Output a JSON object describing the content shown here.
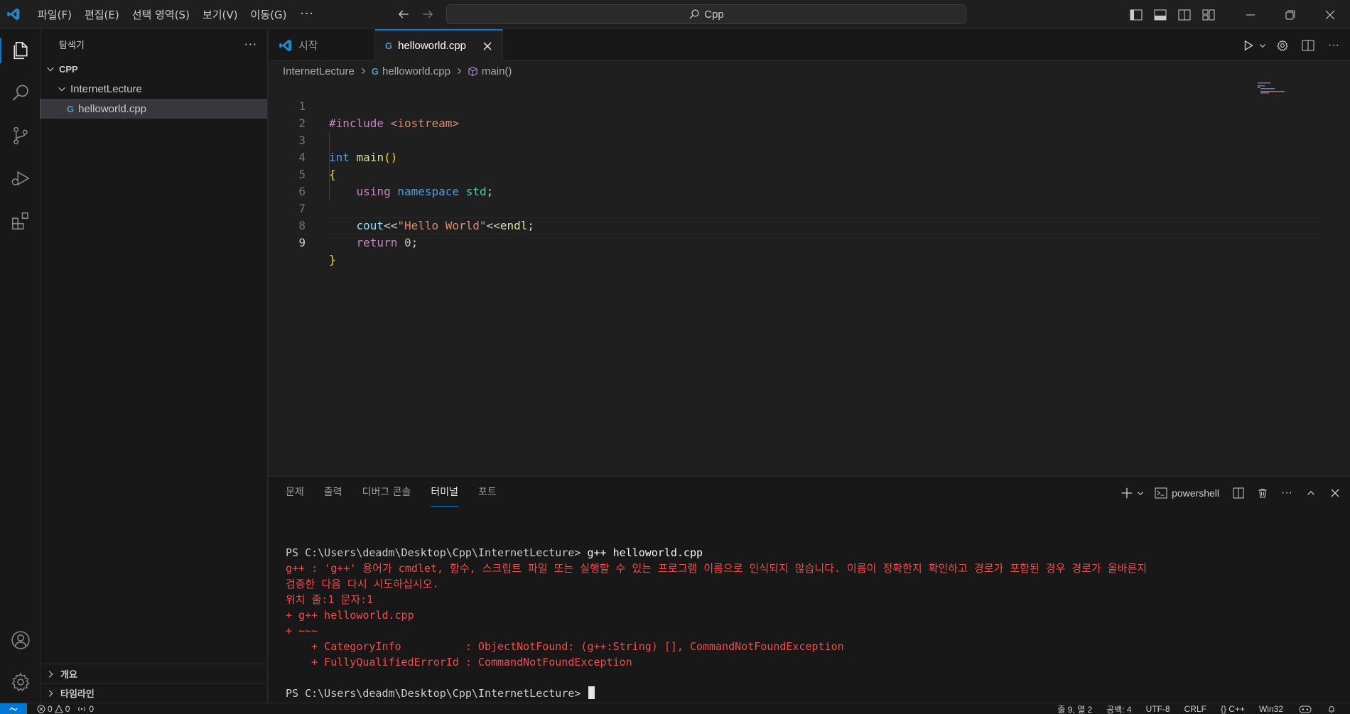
{
  "titlebar": {
    "menus": [
      "파일(F)",
      "편집(E)",
      "선택 영역(S)",
      "보기(V)",
      "이동(G)"
    ],
    "more": "···",
    "search_text": "Cpp"
  },
  "sidebar": {
    "title": "탐색기",
    "more": "···",
    "root": "CPP",
    "folder": "InternetLecture",
    "file": "helloworld.cpp",
    "file_icon": "G",
    "sections": [
      "개요",
      "타임라인"
    ]
  },
  "tabs": [
    {
      "label": "시작"
    },
    {
      "label": "helloworld.cpp",
      "icon": "G"
    }
  ],
  "breadcrumb": {
    "folder": "InternetLecture",
    "file": "helloworld.cpp",
    "symbol": "main()"
  },
  "editor": {
    "line_numbers": [
      "1",
      "2",
      "3",
      "4",
      "5",
      "6",
      "7",
      "8",
      "9"
    ],
    "current_line": 9
  },
  "panel": {
    "tabs": [
      "문제",
      "출력",
      "디버그 콘솔",
      "터미널",
      "포트"
    ],
    "active_tab": "터미널",
    "shell": "powershell",
    "terminal": {
      "prompt1": "PS C:\\Users\\deadm\\Desktop\\Cpp\\InternetLecture> ",
      "cmd1": "g++ helloworld.cpp",
      "err1": "g++ : 'g++' 용어가 cmdlet, 함수, 스크립트 파일 또는 실행할 수 있는 프로그램 이름으로 인식되지 않습니다. 이름이 정확한지 확인하고 경로가 포함된 경우 경로가 올바른지",
      "err2": "검증한 다음 다시 시도하십시오.",
      "err3": "위치 줄:1 문자:1",
      "err4": "+ g++ helloworld.cpp",
      "err5": "+ ~~~",
      "err6": "    + CategoryInfo          : ObjectNotFound: (g++:String) [], CommandNotFoundException",
      "err7": "    + FullyQualifiedErrorId : CommandNotFoundException",
      "prompt2": "PS C:\\Users\\deadm\\Desktop\\Cpp\\InternetLecture> "
    }
  },
  "statusbar": {
    "errors": "0",
    "warnings": "0",
    "ports": "0",
    "position": "줄 9, 열 2",
    "spaces": "공백: 4",
    "encoding": "UTF-8",
    "eol": "CRLF",
    "language": "{} C++",
    "platform": "Win32"
  },
  "colors": {
    "accent": "#0078d4",
    "error_text": "#f14c4c",
    "editor_bg": "#1f1f1f"
  }
}
